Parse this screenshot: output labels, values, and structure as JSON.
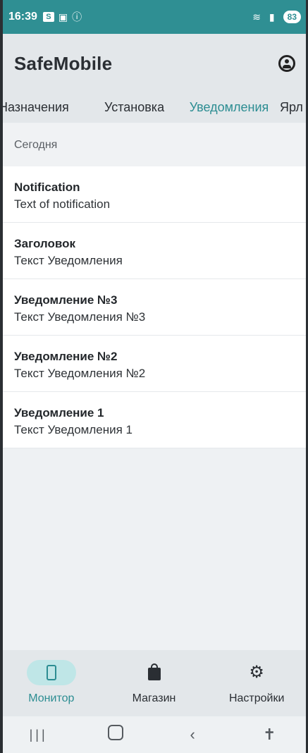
{
  "status_bar": {
    "time": "16:39",
    "battery": "83",
    "icons": [
      "s-icon",
      "nfc-icon",
      "info-icon",
      "wifi-icon",
      "signal-icon",
      "battery-icon"
    ]
  },
  "app": {
    "title": "SafeMobile",
    "profile_icon": "account-circle-icon"
  },
  "tabs": [
    {
      "label": "Назначения"
    },
    {
      "label": "Установка"
    },
    {
      "label": "Уведомления",
      "active": true
    },
    {
      "label": "Ярл"
    }
  ],
  "section": {
    "header": "Сегодня"
  },
  "notifications": [
    {
      "title": "Notification",
      "text": "Text of notification"
    },
    {
      "title": "Заголовок",
      "text": "Текст Уведомления"
    },
    {
      "title": "Уведомление №3",
      "text": "Текст Уведомления №3"
    },
    {
      "title": "Уведомление №2",
      "text": "Текст Уведомления №2"
    },
    {
      "title": "Уведомление 1",
      "text": "Текст Уведомления 1"
    }
  ],
  "bottom_nav": [
    {
      "label": "Монитор",
      "icon": "phone-icon",
      "active": true
    },
    {
      "label": "Магазин",
      "icon": "shopping-bag-icon"
    },
    {
      "label": "Настройки",
      "icon": "gear-icon"
    }
  ],
  "system_nav": [
    "recents-icon",
    "home-icon",
    "back-icon",
    "accessibility-icon"
  ],
  "colors": {
    "accent": "#2c8d92",
    "status_bar": "#2f8f93",
    "app_bar": "#e3e7ea",
    "nav_pill": "#bfe6e7"
  }
}
